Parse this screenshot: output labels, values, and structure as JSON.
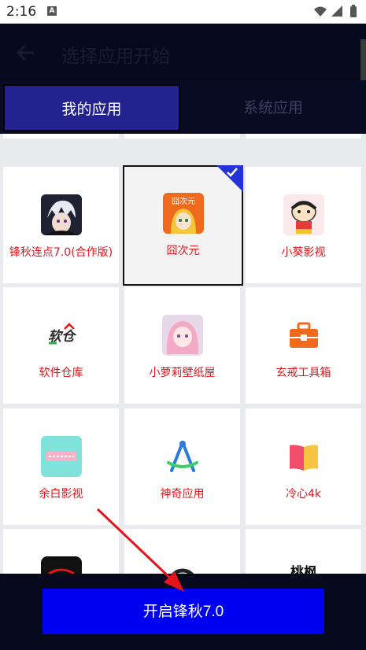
{
  "status_bar": {
    "time": "2:16",
    "badge": "A"
  },
  "header": {
    "title": "选择应用开始"
  },
  "tabs": [
    {
      "label": "我的应用",
      "active": true
    },
    {
      "label": "系统应用",
      "active": false
    }
  ],
  "apps": [
    {
      "label": "锋秋连点7.0(合作版)",
      "icon": "anime-boy-icon",
      "selected": false
    },
    {
      "label": "囧次元",
      "icon": "jiongciyuan-icon",
      "selected": true
    },
    {
      "label": "小葵影视",
      "icon": "crayon-cartoon-icon",
      "selected": false
    },
    {
      "label": "软件仓库",
      "icon": "software-warehouse-icon",
      "icon_text": "软仓",
      "selected": false
    },
    {
      "label": "小萝莉壁纸屋",
      "icon": "anime-girl-icon",
      "selected": false
    },
    {
      "label": "玄戒工具箱",
      "icon": "toolbox-icon",
      "selected": false
    },
    {
      "label": "余白影视",
      "icon": "yubai-video-icon",
      "selected": false
    },
    {
      "label": "神奇应用",
      "icon": "compass-a-icon",
      "selected": false
    },
    {
      "label": "冷心4k",
      "icon": "book-icon",
      "selected": false
    },
    {
      "label": "",
      "icon": "dark-app-icon",
      "selected": false
    },
    {
      "label": "",
      "icon": "green-circle-icon",
      "selected": false
    },
    {
      "label": "",
      "icon": "taofeng-icon",
      "icon_text": "桃枫",
      "selected": false
    }
  ],
  "bottom": {
    "start_label": "开启锋秋7.0"
  },
  "colors": {
    "accent": "#0000f0",
    "label_red": "#e4141b",
    "tab_active": "#23228f",
    "dark_bg": "#060a1c"
  }
}
